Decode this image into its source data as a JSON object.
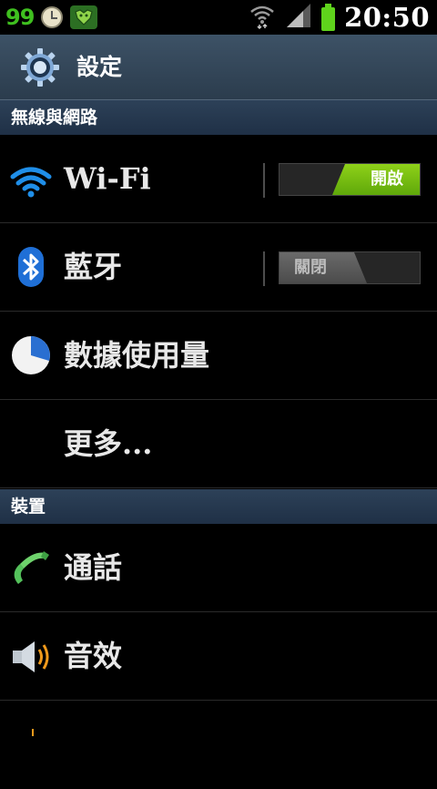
{
  "status_bar": {
    "battery_level_text": "99",
    "time": "20:50",
    "icons": [
      "clock-icon",
      "app-badge-icon",
      "wifi-icon",
      "signal-icon",
      "battery-icon"
    ],
    "battery_color": "#5fd31c"
  },
  "action_bar": {
    "title": "設定",
    "icon": "gear-icon"
  },
  "sections": {
    "wireless": {
      "title": "無線與網路"
    },
    "device": {
      "title": "裝置"
    }
  },
  "rows": {
    "wifi": {
      "label": "Wi-Fi",
      "icon": "wifi-icon",
      "toggle_text": "開啟",
      "toggle_state": "on"
    },
    "bluetooth": {
      "label": "藍牙",
      "icon": "bluetooth-icon",
      "toggle_text": "關閉",
      "toggle_state": "off"
    },
    "data_usage": {
      "label": "數據使用量",
      "icon": "pie-chart-icon"
    },
    "more": {
      "label": "更多..."
    },
    "call": {
      "label": "通話",
      "icon": "phone-icon"
    },
    "sound": {
      "label": "音效",
      "icon": "speaker-icon"
    }
  },
  "colors": {
    "accent_on": "#7cc313",
    "section_header": "#2b3f55",
    "action_bar": "#354a5e"
  }
}
